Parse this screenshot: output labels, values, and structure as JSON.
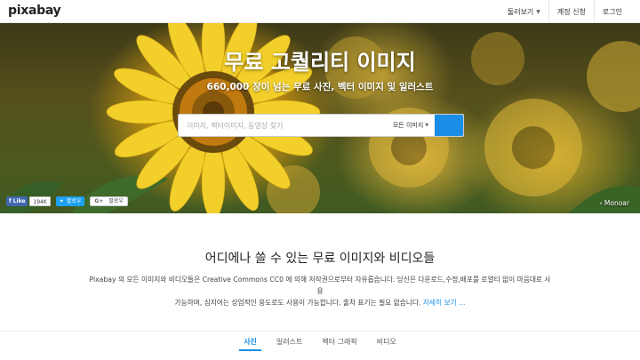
{
  "header": {
    "logo": "pixabay",
    "nav": {
      "explore": "둘러보기",
      "signup": "계정 신청",
      "login": "로그인"
    }
  },
  "hero": {
    "title": "무료 고퀄리티 이미지",
    "subtitle": "660,000 장이 넘는 무료 사진, 벡터 이미지 및 일러스트",
    "search": {
      "placeholder": "이미지, 벡터이미지, 동영상 찾기",
      "type_selected": "모든 이미지"
    },
    "social": {
      "fb_like": "Like",
      "fb_count": "194K",
      "twitter": "팔로우",
      "gplus": "팔로우",
      "gplus_glyph": "G+"
    },
    "credit": "Monoar"
  },
  "intro": {
    "title": "어디에나 쓸 수 있는 무료 이미지와 비디오들",
    "desc_line1": "Pixabay 의 모든 이미지와 비디오들은 Creative Commons CC0 에 의해 저작권으로부터 자유롭습니다. 당신은 다운로드,수정,배포를 로열티 없이 마음대로 사용",
    "desc_line2": "가능하며, 심지어는 상업적인 용도로도 사용이 가능합니다. 출처 표기는 필요 없습니다.",
    "more_link": "자세히 보기 ..."
  },
  "tabs": [
    {
      "label": "사진"
    },
    {
      "label": "일러스트"
    },
    {
      "label": "벡터 그래픽"
    },
    {
      "label": "비디오"
    }
  ],
  "colors": {
    "accent": "#1a8ee6",
    "facebook": "#4267b2",
    "twitter": "#1da1f2"
  }
}
